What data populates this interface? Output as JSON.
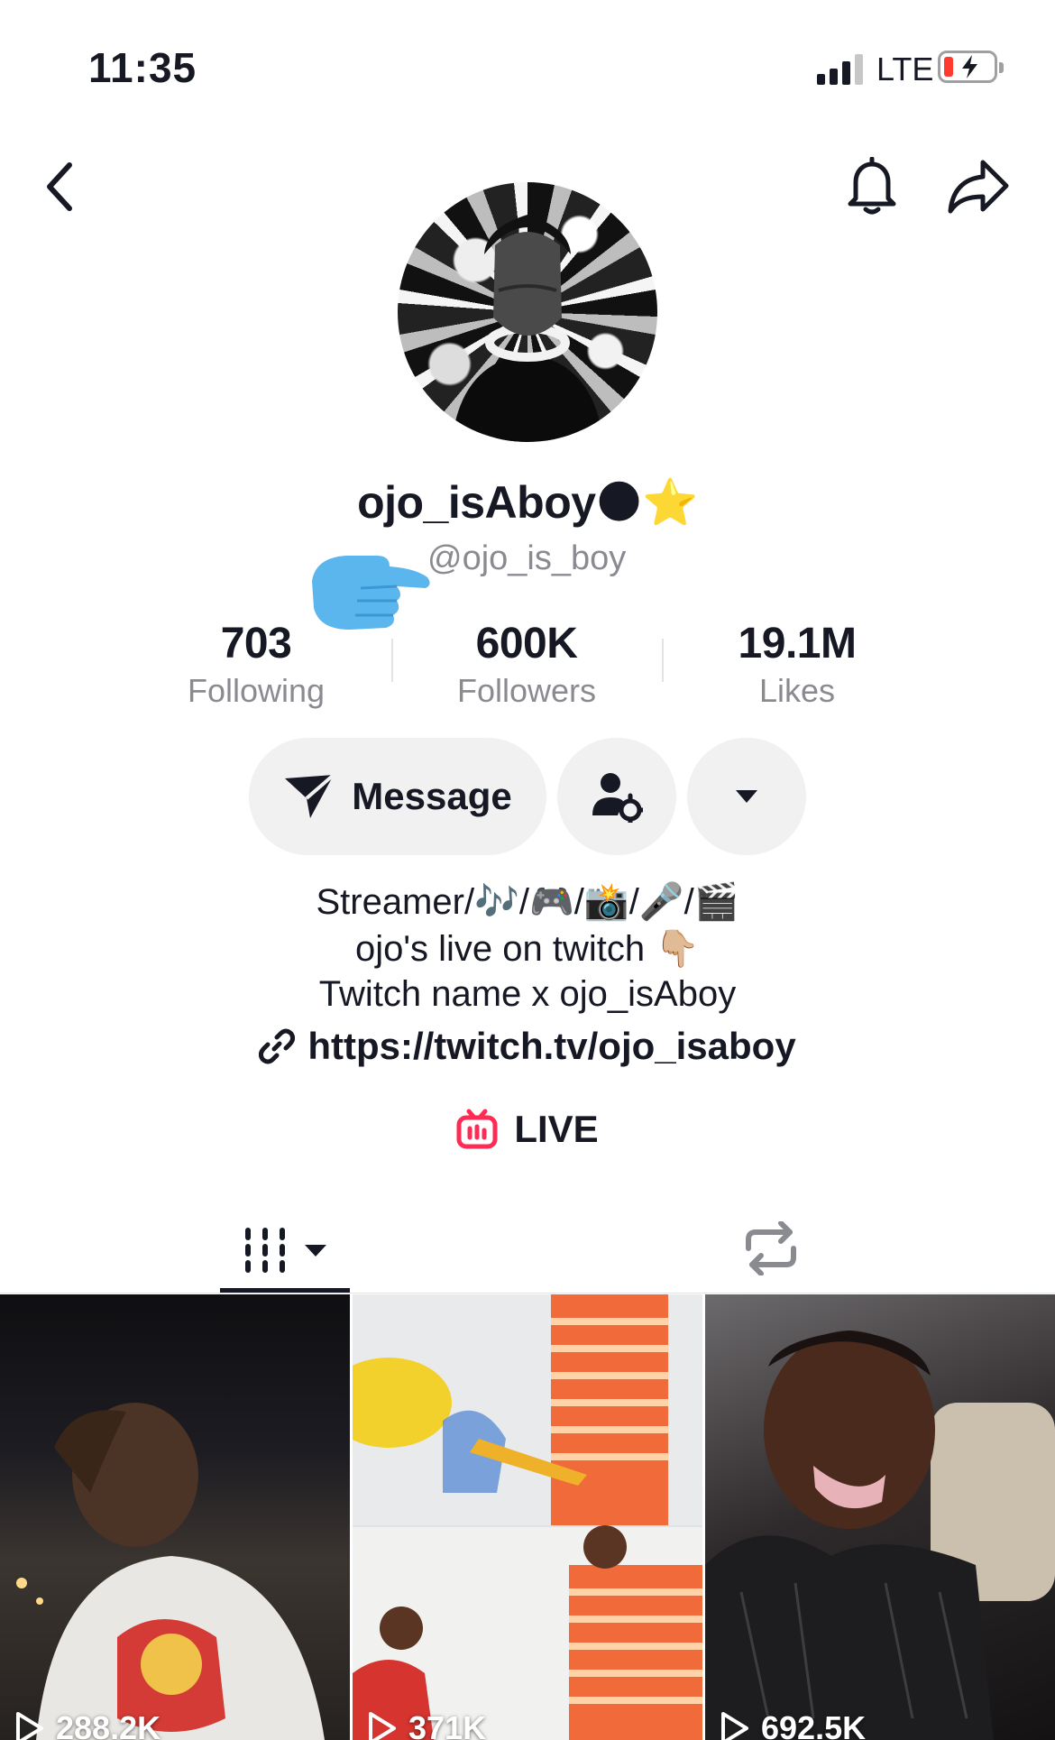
{
  "status_bar": {
    "time": "11:35",
    "network": "LTE"
  },
  "profile": {
    "display_name": "ojo_isAboy🌑⭐",
    "username": "@ojo_is_boy",
    "stats": [
      {
        "value": "703",
        "label": "Following"
      },
      {
        "value": "600K",
        "label": "Followers"
      },
      {
        "value": "19.1M",
        "label": "Likes"
      }
    ],
    "bio": [
      "Streamer/🎶/🎮/📸/🎤/🎬",
      "ojo's live on twitch 👇🏼",
      "Twitch name x ojo_isAboy"
    ],
    "link": "https://twitch.tv/ojo_isaboy",
    "live_label": "LIVE"
  },
  "actions": {
    "message_label": "Message"
  },
  "icons": {
    "back": "back-chevron-icon",
    "bell": "bell-icon",
    "share": "share-arrow-icon",
    "send": "send-paper-plane-icon",
    "friend_settings": "user-gear-icon",
    "more": "dropdown-triangle-icon",
    "link": "link-icon",
    "live": "live-tv-icon",
    "videos_tab": "videos-grid-icon",
    "reposts_tab": "repost-icon",
    "play": "play-outline-icon"
  },
  "colors": {
    "live_accent": "#fe2c55",
    "text": "#161823",
    "secondary": "#8a8b91"
  },
  "videos": [
    {
      "views": "288.2K"
    },
    {
      "views": "371K"
    },
    {
      "views": "692.5K"
    }
  ]
}
